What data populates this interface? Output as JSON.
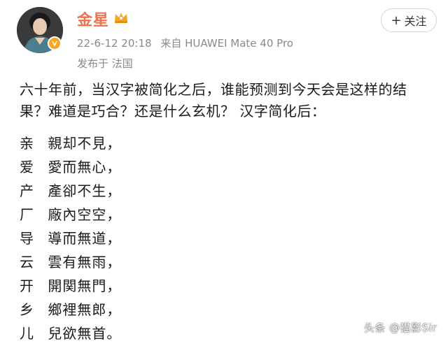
{
  "post": {
    "username": "金星",
    "timestamp": "22-6-12 20:18",
    "source": "来自 HUAWEI Mate 40 Pro",
    "location": "发布于 法国",
    "follow_label": "关注",
    "follow_plus": "+",
    "paragraph": "六十年前，当汉字被简化之后，谁能预测到今天会是这样的结果？难道是巧合？还是什么玄机？  汉字简化后：",
    "char_rows": [
      {
        "simplified": "亲",
        "traditional": "親却不見，"
      },
      {
        "simplified": "爱",
        "traditional": "愛而無心，"
      },
      {
        "simplified": "产",
        "traditional": "產卻不生，"
      },
      {
        "simplified": "厂",
        "traditional": "廠內空空，"
      },
      {
        "simplified": "导",
        "traditional": "導而無道，"
      },
      {
        "simplified": "云",
        "traditional": "雲有無雨，"
      },
      {
        "simplified": "开",
        "traditional": "開関無門，"
      },
      {
        "simplified": "乡",
        "traditional": "鄉裡無郎，"
      },
      {
        "simplified": "儿",
        "traditional": "兒欲無首。"
      }
    ]
  },
  "watermark": "头条 @猫影Sir",
  "colors": {
    "username": "#eb7350",
    "meta": "#8a8a8a",
    "badge": "#f5a623",
    "text": "#1a1a1a"
  },
  "icons": {
    "crown": "crown-icon",
    "verified": "verified-badge-icon"
  }
}
